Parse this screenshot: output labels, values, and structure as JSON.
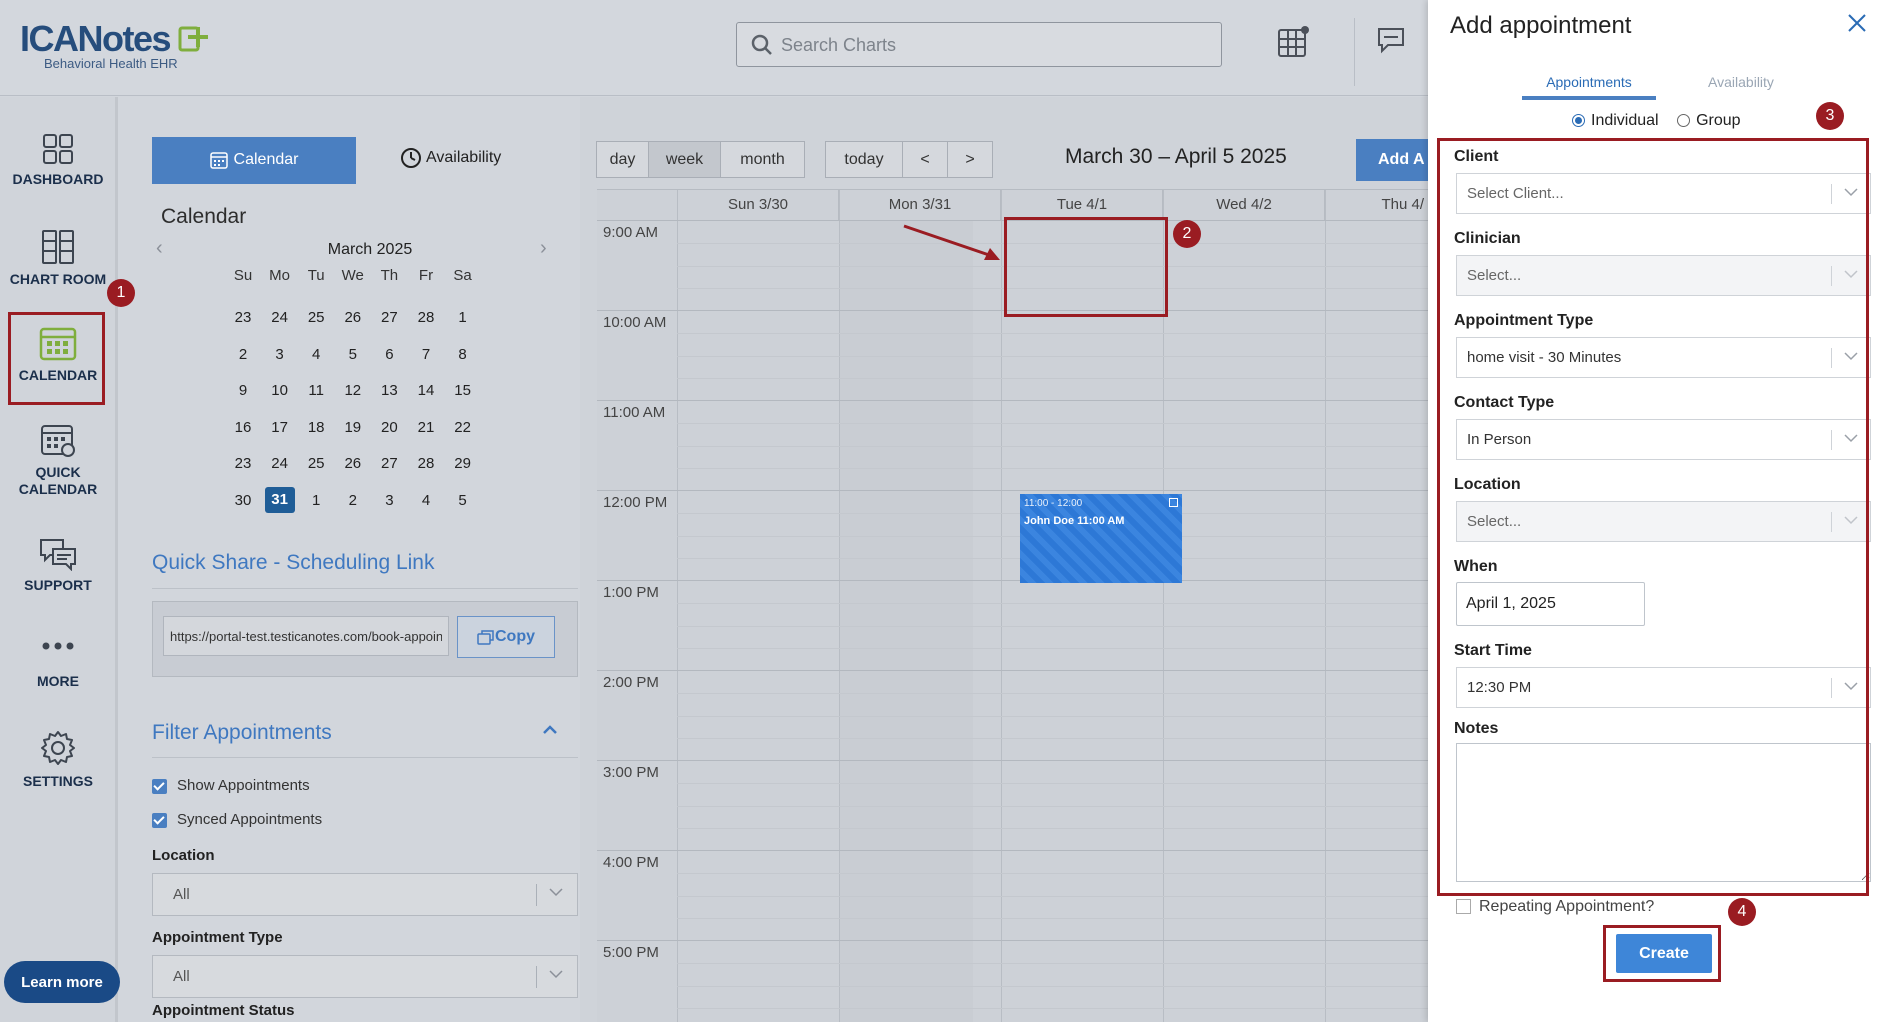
{
  "app": {
    "brand": "ICANotes",
    "tagline": "Behavioral Health EHR",
    "search_placeholder": "Search Charts"
  },
  "icons": {
    "search": "search-icon",
    "chart_grid": "chart-grid-icon",
    "chat": "chat-icon",
    "close": "close-icon",
    "chevron": "chevron-down-icon"
  },
  "nav": {
    "dashboard": "DASHBOARD",
    "chart_room": "CHART ROOM",
    "calendar": "CALENDAR",
    "quick_calendar_1": "QUICK",
    "quick_calendar_2": "CALENDAR",
    "support": "SUPPORT",
    "more": "MORE",
    "settings": "SETTINGS",
    "learn_more": "Learn more"
  },
  "panel": {
    "tab_calendar": "Calendar",
    "tab_availability": "Availability",
    "mini_title": "Calendar",
    "mini_month": "March 2025",
    "prev": "‹",
    "next": "›",
    "weekdays": [
      "Su",
      "Mo",
      "Tu",
      "We",
      "Th",
      "Fr",
      "Sa"
    ],
    "weeks": [
      [
        "23",
        "24",
        "25",
        "26",
        "27",
        "28",
        "1"
      ],
      [
        "2",
        "3",
        "4",
        "5",
        "6",
        "7",
        "8"
      ],
      [
        "9",
        "10",
        "11",
        "12",
        "13",
        "14",
        "15"
      ],
      [
        "16",
        "17",
        "18",
        "19",
        "20",
        "21",
        "22"
      ],
      [
        "23",
        "24",
        "25",
        "26",
        "27",
        "28",
        "29"
      ],
      [
        "30",
        "31",
        "1",
        "2",
        "3",
        "4",
        "5"
      ]
    ],
    "selected_day": "31",
    "quick_share_title": "Quick Share - Scheduling Link",
    "quick_share_link": "https://portal-test.testicanotes.com/book-appointment",
    "copy_label": "Copy",
    "filter_title": "Filter Appointments",
    "show_appointments": "Show Appointments",
    "synced_appointments": "Synced Appointments",
    "location_label": "Location",
    "location_value": "All",
    "appt_type_label": "Appointment Type",
    "appt_type_value": "All",
    "appt_status_label": "Appointment Status"
  },
  "calendar": {
    "views": [
      "day",
      "week",
      "month"
    ],
    "active_view": "week",
    "today": "today",
    "prev": "<",
    "next": ">",
    "range_title": "March 30 – April 5 2025",
    "add_button": "Add A",
    "days": [
      "Sun 3/30",
      "Mon 3/31",
      "Tue 4/1",
      "Wed 4/2",
      "Thu 4/"
    ],
    "hours": [
      "9:00 AM",
      "10:00 AM",
      "11:00 AM",
      "12:00 PM",
      "1:00 PM",
      "2:00 PM",
      "3:00 PM",
      "4:00 PM",
      "5:00 PM"
    ],
    "event": {
      "time": "11:00 - 12:00",
      "title": "John Doe 11:00 AM"
    }
  },
  "annotations": {
    "colors": {
      "highlight": "#9a1c22"
    },
    "badges": [
      "1",
      "2",
      "3",
      "4"
    ]
  },
  "drawer": {
    "title": "Add appointment",
    "tab_appointments": "Appointments",
    "tab_availability": "Availability",
    "mode_individual": "Individual",
    "mode_group": "Group",
    "client_label": "Client",
    "client_placeholder": "Select Client...",
    "clinician_label": "Clinician",
    "clinician_placeholder": "Select...",
    "appt_type_label": "Appointment Type",
    "appt_type_value": "home visit - 30 Minutes",
    "contact_type_label": "Contact Type",
    "contact_type_value": "In Person",
    "location_label": "Location",
    "location_placeholder": "Select...",
    "when_label": "When",
    "when_value": "April 1, 2025",
    "start_time_label": "Start Time",
    "start_time_value": "12:30 PM",
    "notes_label": "Notes",
    "repeating_label": "Repeating Appointment?",
    "create_label": "Create"
  }
}
